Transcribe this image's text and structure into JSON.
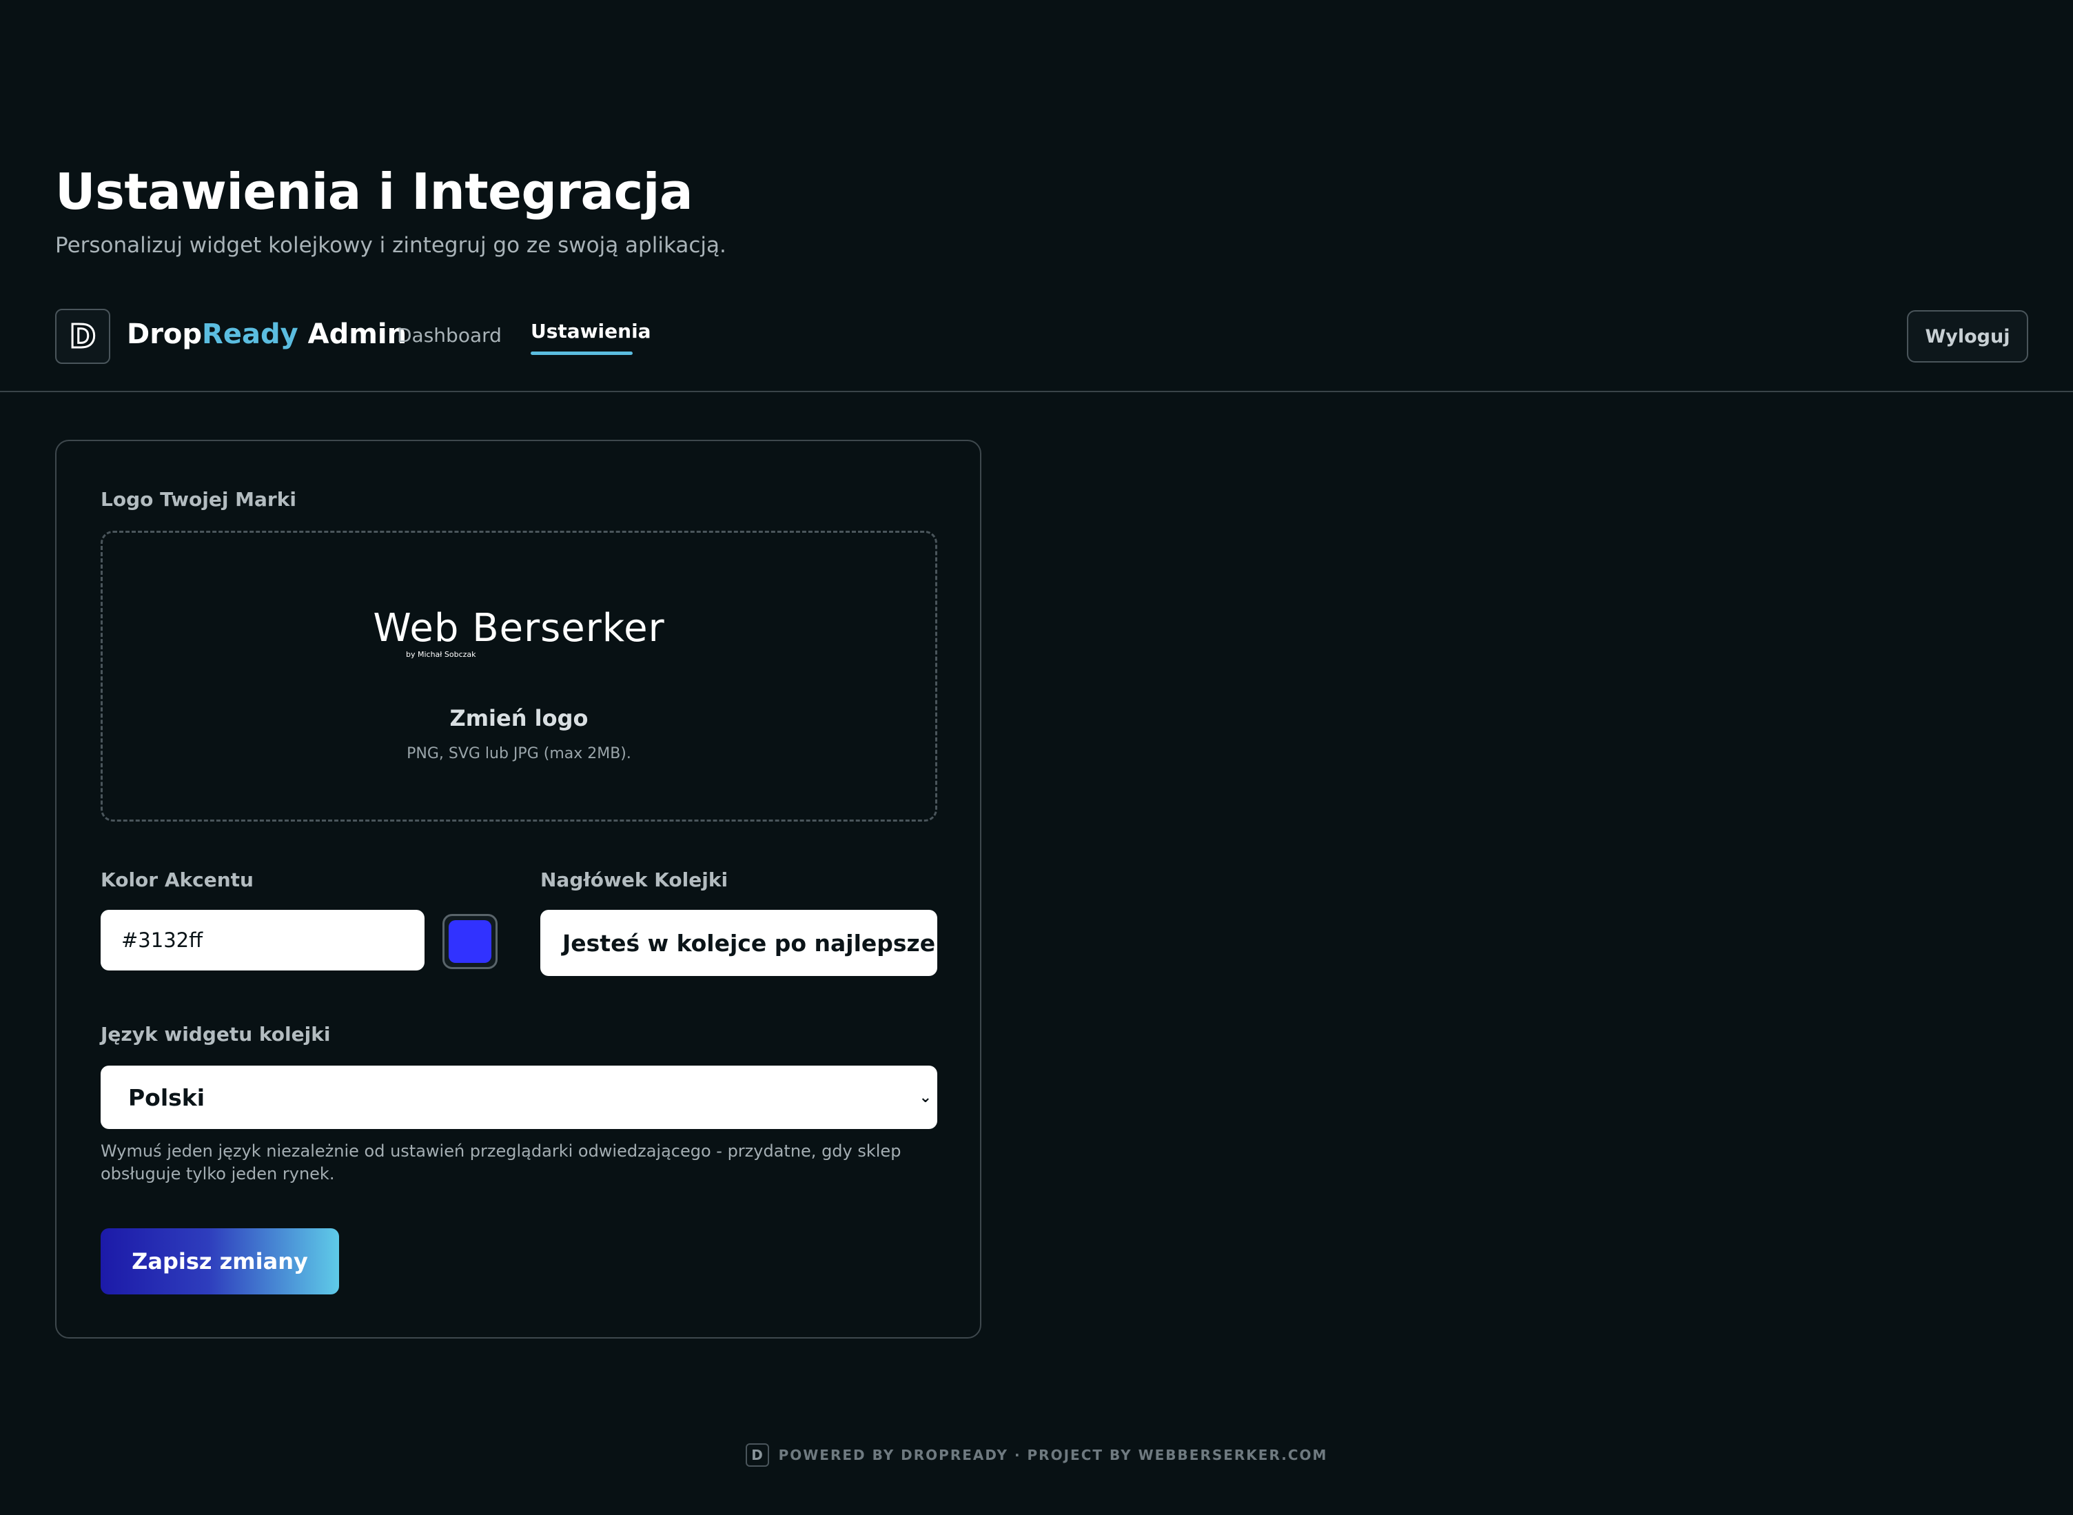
{
  "header": {
    "title": "Ustawienia i Integracja",
    "subtitle": "Personalizuj widget kolejkowy i zintegruj go ze swoją aplikacją."
  },
  "nav": {
    "logo_letter": "D",
    "brand_part1": "Drop",
    "brand_part2": "Ready",
    "brand_part3": "Admin",
    "links": [
      {
        "label": "Dashboard",
        "active": false
      },
      {
        "label": "Ustawienia",
        "active": true
      }
    ],
    "logout_label": "Wyloguj"
  },
  "form": {
    "logo_label": "Logo Twojej Marki",
    "logo_preview": {
      "name": "Web Berserker",
      "byline": "by Michał Sobczak"
    },
    "change_logo_label": "Zmień logo",
    "logo_hint": "PNG, SVG lub JPG (max 2MB).",
    "accent_label": "Kolor Akcentu",
    "accent_value": "#3132ff",
    "header_label": "Nagłówek Kolejki",
    "header_value": "Jesteś w kolejce po najlepsze ofe",
    "language_label": "Język widgetu kolejki",
    "language_value": "Polski",
    "language_help": "Wymuś jeden język niezależnie od ustawień przeglądarki odwiedzającego - przydatne, gdy sklep obsługuje tylko jeden rynek.",
    "save_label": "Zapisz zmiany"
  },
  "footer": {
    "badge": "D",
    "text": "POWERED BY DROPREADY · PROJECT BY WEBBERSERKER.COM"
  },
  "colors": {
    "background": "#081114",
    "brand_accent": "#5bbde0",
    "accent_swatch": "#3132ff"
  },
  "icons": {
    "select_chevron": "chevron-down-icon"
  }
}
